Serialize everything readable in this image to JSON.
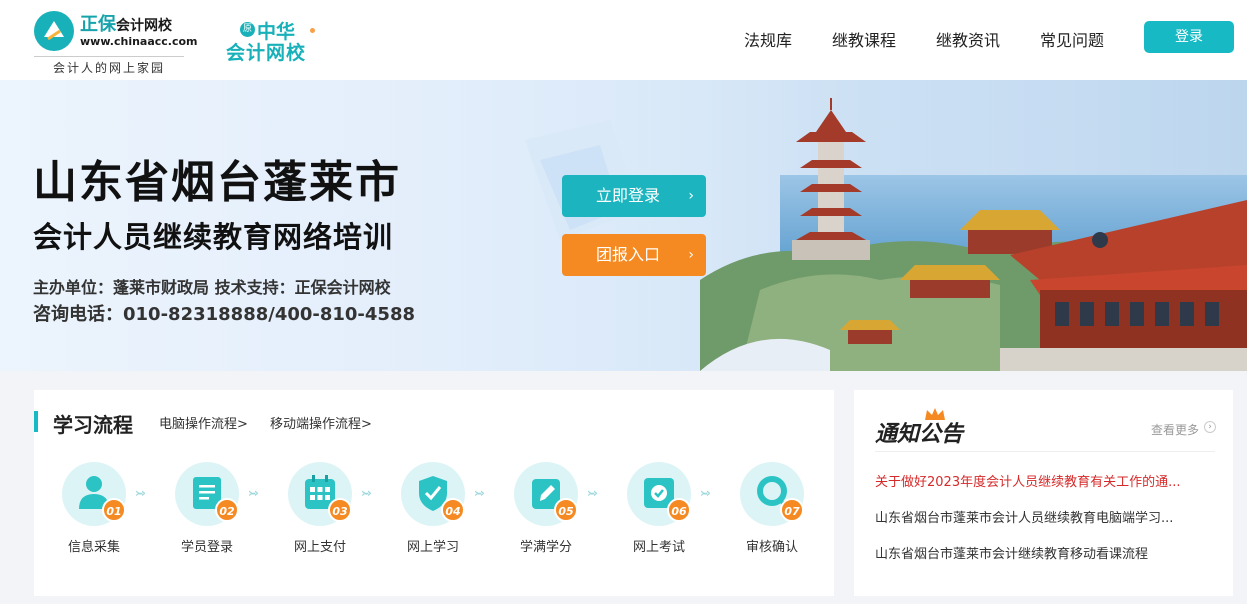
{
  "header": {
    "logo_brand": "正保",
    "logo_brand_suffix": "会计网校",
    "logo_url": "www.chinaacc.com",
    "logo_slogan": "会计人的网上家园",
    "logo2_badge": "原",
    "logo2_line1": "中华",
    "logo2_line2": "会计网校",
    "nav": [
      "法规库",
      "继教课程",
      "继教资讯",
      "常见问题"
    ],
    "login_label": "登录"
  },
  "banner": {
    "title": "山东省烟台蓬莱市",
    "subtitle": "会计人员继续教育网络培训",
    "organizer": "主办单位：蓬莱市财政局  技术支持：正保会计网校",
    "hotline": "咨询电话：010-82318888/400-810-4588",
    "login_button": "立即登录",
    "group_button": "团报入口",
    "arrow": "›"
  },
  "process": {
    "title": "学习流程",
    "pc_link": "电脑操作流程>",
    "mobile_link": "移动端操作流程>",
    "steps": [
      {
        "num": "01",
        "label": "信息采集",
        "icon": "user-icon"
      },
      {
        "num": "02",
        "label": "学员登录",
        "icon": "document-icon"
      },
      {
        "num": "03",
        "label": "网上支付",
        "icon": "calendar-icon"
      },
      {
        "num": "04",
        "label": "网上学习",
        "icon": "shield-check-icon"
      },
      {
        "num": "05",
        "label": "学满学分",
        "icon": "edit-icon"
      },
      {
        "num": "06",
        "label": "网上考试",
        "icon": "exam-icon"
      },
      {
        "num": "07",
        "label": "审核确认",
        "icon": "search-icon"
      }
    ]
  },
  "notice": {
    "title": "通知公告",
    "more": "查看更多",
    "items": [
      "关于做好2023年度会计人员继续教育有关工作的通...",
      "山东省烟台市蓬莱市会计人员继续教育电脑端学习...",
      "山东省烟台市蓬莱市会计继续教育移动看课流程"
    ]
  },
  "colors": {
    "accent": "#17bac4",
    "orange": "#f58a22",
    "hot_notice": "#d62a2a"
  }
}
